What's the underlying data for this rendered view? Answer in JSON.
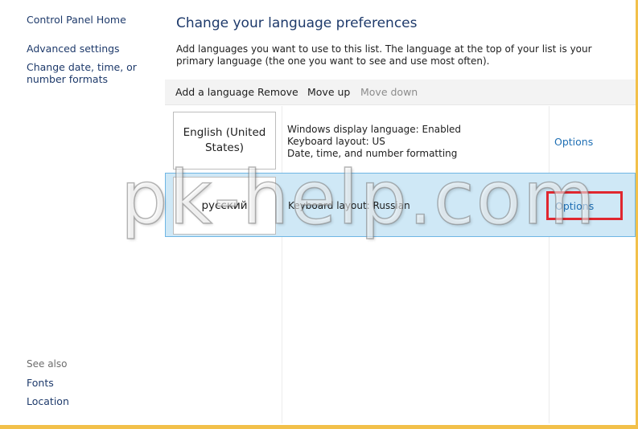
{
  "nav": {
    "home": "Control Panel Home",
    "advanced": "Advanced settings",
    "datetime": "Change date, time, or number formats",
    "see_also": "See also",
    "fonts": "Fonts",
    "location": "Location"
  },
  "main": {
    "title": "Change your language preferences",
    "description": "Add languages you want to use to this list. The language at the top of your list is your primary language (the one you want to see and use most often)."
  },
  "toolbar": {
    "add": "Add a language",
    "remove": "Remove",
    "move_up": "Move up",
    "move_down": "Move down"
  },
  "languages": [
    {
      "name": "English (United States)",
      "details": [
        "Windows display language: Enabled",
        "Keyboard layout: US",
        "Date, time, and number formatting"
      ],
      "options": "Options"
    },
    {
      "name": "русский",
      "details": [
        "Keyboard layout: Russian"
      ],
      "options": "Options"
    }
  ],
  "watermark": "pk-help.com",
  "colors": {
    "link": "#1e3a6b",
    "options_link": "#1f6fb4",
    "selected_row": "#cfe8f6",
    "highlight": "#e0272f"
  }
}
